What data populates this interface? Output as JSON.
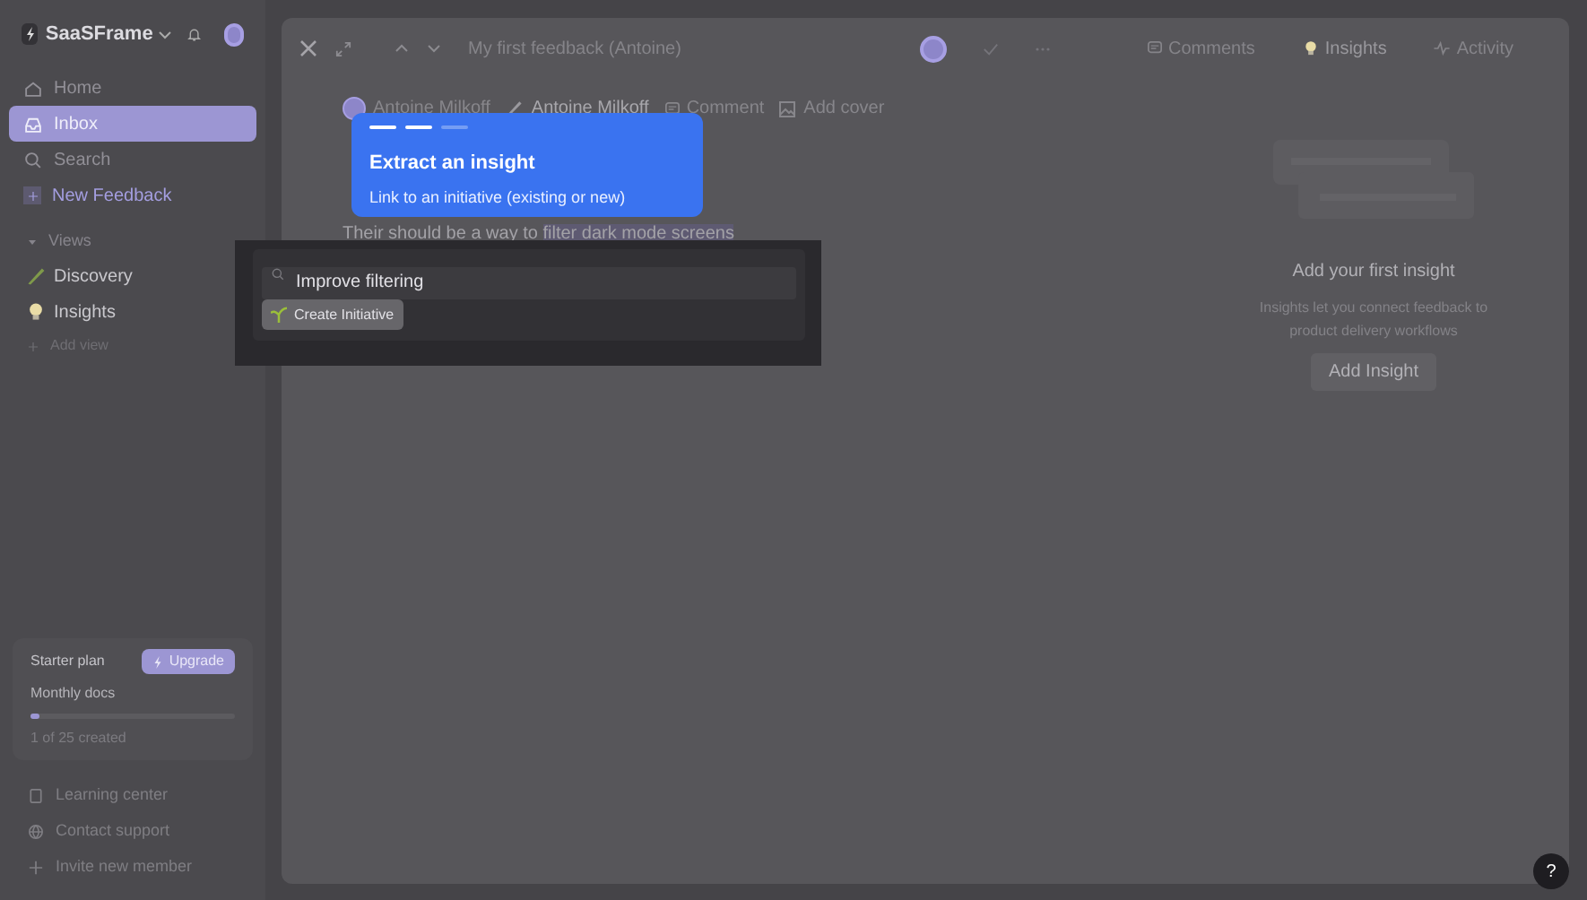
{
  "workspace": {
    "name": "SaaSFrame"
  },
  "nav": [
    {
      "label": "Home",
      "selected": false
    },
    {
      "label": "Inbox",
      "selected": true
    },
    {
      "label": "Search",
      "selected": false
    },
    {
      "label": "New Feedback",
      "selected": false
    }
  ],
  "views": {
    "heading": "Views",
    "expanded": true,
    "items": [
      {
        "label": "Discovery"
      },
      {
        "label": "Insights"
      }
    ],
    "add": "Add view"
  },
  "plan": {
    "name": "Starter plan",
    "upgrade": "Upgrade",
    "meter_label": "Monthly docs",
    "level": 0.04,
    "usage": "1 of 25 created"
  },
  "footer_links": [
    {
      "label": "Learning center"
    },
    {
      "label": "Contact support"
    },
    {
      "label": "Invite new member"
    }
  ],
  "doc": {
    "title": "My first feedback (Antoine)",
    "author": "Antoine Milkoff",
    "assignee": "Antoine Milkoff",
    "comment": "Comment",
    "add_cover": "Add cover",
    "body": "Their should be a way to ",
    "highlight": "filter dark mode screens"
  },
  "tabs": [
    {
      "label": "Comments",
      "selected": false
    },
    {
      "label": "Insights",
      "selected": true
    },
    {
      "label": "Activity",
      "selected": false
    }
  ],
  "empty": {
    "title": "Add your first insight",
    "text": "Insights let you connect feedback to product delivery workflows",
    "button": "Add Insight"
  },
  "tour": {
    "steps": [
      {
        "done": true
      },
      {
        "done": true
      },
      {
        "done": false
      }
    ],
    "title": "Extract an insight",
    "text": "Link to an initiative (existing or new)"
  },
  "popup": {
    "value": "Improve filtering",
    "button": "Create Initiative"
  },
  "help": "?"
}
